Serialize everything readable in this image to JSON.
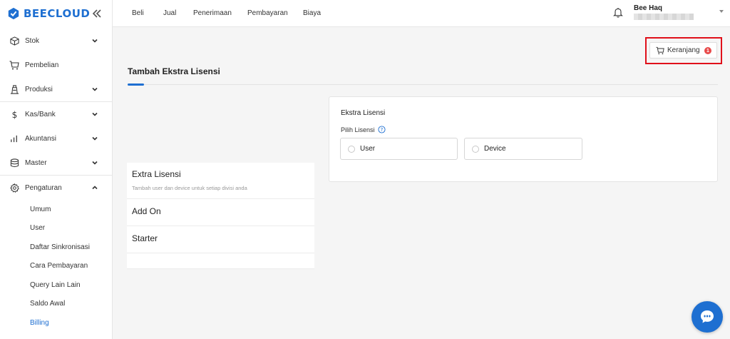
{
  "brand": {
    "name": "BEECLOUD",
    "color": "#1e6fd1"
  },
  "sidebar": {
    "items": [
      {
        "label": "Stok",
        "icon": "box-icon",
        "expandable": true
      },
      {
        "label": "Pembelian",
        "icon": "cart-icon",
        "expandable": false
      },
      {
        "label": "Produksi",
        "icon": "factory-icon",
        "expandable": true
      },
      {
        "label": "Kas/Bank",
        "icon": "dollar-icon",
        "expandable": true
      },
      {
        "label": "Akuntansi",
        "icon": "bar-chart-icon",
        "expandable": true
      },
      {
        "label": "Master",
        "icon": "database-icon",
        "expandable": true
      },
      {
        "label": "Pengaturan",
        "icon": "gear-icon",
        "expandable": true,
        "expanded": true
      }
    ],
    "subitems": [
      "Umum",
      "User",
      "Daftar Sinkronisasi",
      "Cara Pembayaran",
      "Query Lain Lain",
      "Saldo Awal",
      "Billing"
    ],
    "active_subitem": "Billing"
  },
  "topnav": {
    "links": [
      "Beli",
      "Jual",
      "Penerimaan",
      "Pembayaran",
      "Biaya"
    ],
    "user_name": "Bee Haq"
  },
  "cart": {
    "label": "Keranjang",
    "count": "1",
    "badge_color": "#e84a4a"
  },
  "page": {
    "title": "Tambah Ekstra Lisensi"
  },
  "products": [
    {
      "name": "Extra Lisensi",
      "description": "Tambah user dan device untuk setiap divisi anda"
    },
    {
      "name": "Add On"
    },
    {
      "name": "Starter"
    }
  ],
  "panel": {
    "title": "Ekstra Lisensi",
    "label": "Pilih Lisensi",
    "options": [
      "User",
      "Device"
    ]
  },
  "colors": {
    "accent": "#1e6fd1",
    "highlight": "#e0101a"
  }
}
